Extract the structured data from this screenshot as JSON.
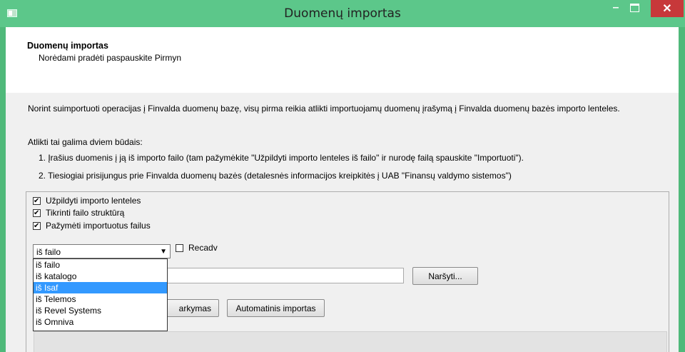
{
  "window": {
    "title": "Duomenų importas",
    "minimize": "–",
    "close": "✕"
  },
  "header": {
    "title": "Duomenų importas",
    "subtitle": "Norėdami pradėti paspauskite Pirmyn"
  },
  "content": {
    "description": "Norint suimportuoti operacijas į Finvalda duomenų bazę, visų pirma reikia atlikti importuojamų duomenų įrašymą į Finvalda duomenų bazės importo lenteles.",
    "ways_intro": "Atlikti tai galima dviem būdais:",
    "item1": "1. Įrašius duomenis į ją iš importo failo (tam pažymėkite \"Užpildyti importo lenteles iš failo\" ir nurodę failą spauskite \"Importuoti\").",
    "item2": "2. Tiesiogiai prisijungus prie Finvalda duomenų bazės (detalesnės informacijos kreipkitės į UAB \"Finansų valdymo sistemos\")"
  },
  "options": {
    "fill_tables": {
      "label": "Užpildyti importo lenteles",
      "checked": true
    },
    "check_structure": {
      "label": "Tikrinti failo struktūrą",
      "checked": true
    },
    "mark_imported": {
      "label": "Pažymėti importuotus failus",
      "checked": true
    },
    "recadv": {
      "label": "Recadv",
      "checked": false
    }
  },
  "source_select": {
    "selected": "iš failo",
    "options": [
      "iš failo",
      "iš katalogo",
      "iš Isaf",
      "iš Telemos",
      "iš Revel Systems",
      "iš Omniva"
    ],
    "highlighted_index": 2
  },
  "buttons": {
    "browse": "Naršyti...",
    "partial": "arkymas",
    "auto_import": "Automatinis importas"
  },
  "colors": {
    "titlebar": "#5cc78a",
    "close": "#c7383a",
    "selection": "#3399ff"
  }
}
